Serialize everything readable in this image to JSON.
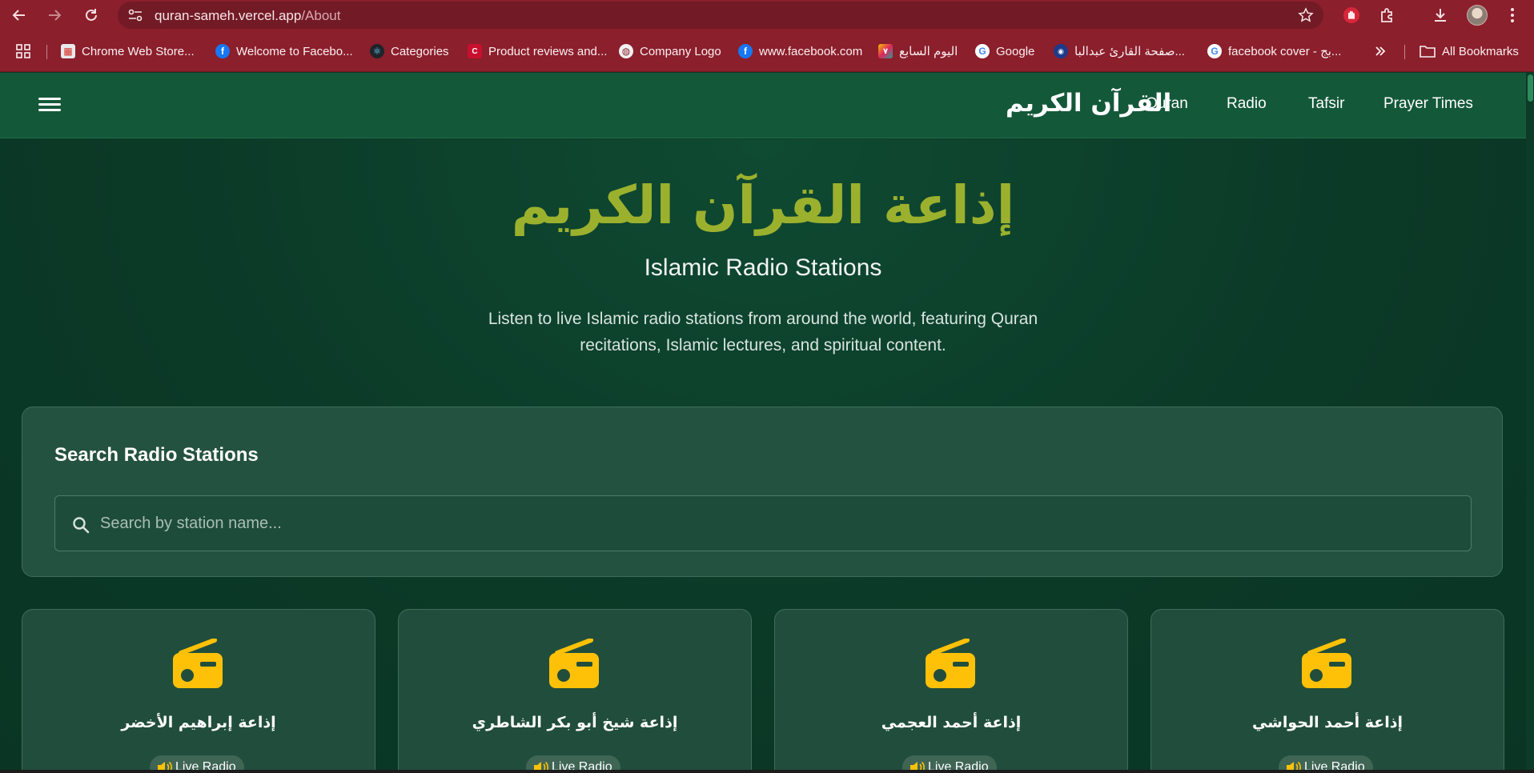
{
  "browser": {
    "url_host": "quran-sameh.vercel.app",
    "url_path": "/About",
    "bookmarks": [
      {
        "label": "Chrome Web Store...",
        "icon": "chrome-web-store-icon"
      },
      {
        "label": "Welcome to Facebo...",
        "icon": "facebook-icon"
      },
      {
        "label": "Categories",
        "icon": "react-icon"
      },
      {
        "label": "Product reviews and...",
        "icon": "product-reviews-icon"
      },
      {
        "label": "Company Logo",
        "icon": "globe-icon"
      },
      {
        "label": "www.facebook.com",
        "icon": "facebook-icon"
      },
      {
        "label": "اليوم السابع",
        "icon": "youm7-icon"
      },
      {
        "label": "Google",
        "icon": "google-icon"
      },
      {
        "label": "صفحة القارئ عبدالبا...",
        "icon": "reciter-page-icon"
      },
      {
        "label": "facebook cover - بج...",
        "icon": "google-icon"
      }
    ],
    "all_bookmarks_label": "All Bookmarks"
  },
  "header": {
    "brand": "القرآن الكريم",
    "nav": [
      "Quran",
      "Radio",
      "Tafsir",
      "Prayer Times"
    ]
  },
  "hero": {
    "title_ar": "إذاعة القرآن الكريم",
    "title_en": "Islamic Radio Stations",
    "description": "Listen to live Islamic radio stations from around the world, featuring Quran recitations, Islamic lectures, and spiritual content."
  },
  "search": {
    "title": "Search Radio Stations",
    "placeholder": "Search by station name..."
  },
  "stations": [
    {
      "name": "إذاعة إبراهيم الأخضر",
      "badge": "Live Radio"
    },
    {
      "name": "إذاعة شيخ أبو بكر الشاطري",
      "badge": "Live Radio"
    },
    {
      "name": "إذاعة أحمد العجمي",
      "badge": "Live Radio"
    },
    {
      "name": "إذاعة أحمد الحواشي",
      "badge": "Live Radio"
    }
  ],
  "colors": {
    "browser_frame": "#8b1f2c",
    "header_bg": "#14583a",
    "page_bg": "#0b3a27",
    "hero_title": "#9bb12e",
    "radio_icon": "#ffc107",
    "card_bg": "#214e3c"
  }
}
